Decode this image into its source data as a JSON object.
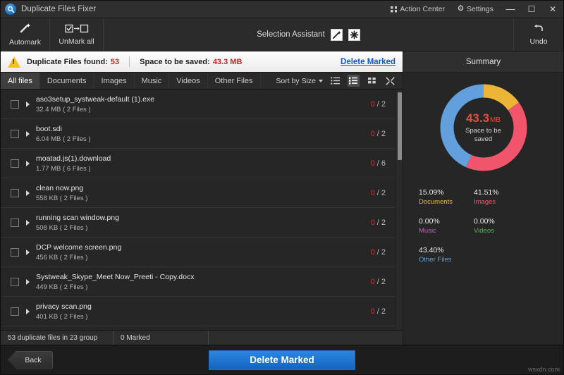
{
  "titlebar": {
    "app_name": "Duplicate Files Fixer",
    "logo_icon": "magnifier-circle-icon",
    "action_center": "Action Center",
    "settings": "Settings",
    "minimize": "—",
    "maximize": "☐",
    "close": "✕"
  },
  "toolbar": {
    "automark": "Automark",
    "unmark_all": "UnMark all",
    "selection_assistant": "Selection Assistant",
    "undo": "Undo",
    "icons": {
      "automark": "magic-wand-icon",
      "unmark_all": "checkbox-to-empty-icon",
      "assistant_wand": "wand-icon",
      "assistant_star": "star-burst-icon",
      "undo": "undo-arrow-icon"
    }
  },
  "infobar": {
    "warning_icon": "warning-triangle-icon",
    "found_label": "Duplicate Files found:",
    "found_value": "53",
    "space_label": "Space to be saved:",
    "space_value": "43.3 MB",
    "delete_marked_link": "Delete Marked"
  },
  "tabs": [
    {
      "label": "All files",
      "active": true
    },
    {
      "label": "Documents",
      "active": false
    },
    {
      "label": "Images",
      "active": false
    },
    {
      "label": "Music",
      "active": false
    },
    {
      "label": "Videos",
      "active": false
    },
    {
      "label": "Other Files",
      "active": false
    }
  ],
  "listcontrols": {
    "sort_by": "Sort by Size",
    "views": [
      "list-view-icon",
      "detail-view-icon",
      "grid-view-icon",
      "expand-view-icon"
    ],
    "selected_view": 1
  },
  "rows": [
    {
      "name": "aso3setup_systweak-default (1).exe",
      "meta": "32.4 MB  ( 2 Files )",
      "marked": "0",
      "total": "2",
      "checked": false
    },
    {
      "name": "boot.sdi",
      "meta": "6.04 MB  ( 2 Files )",
      "marked": "0",
      "total": "2",
      "checked": false
    },
    {
      "name": "moatad.js(1).download",
      "meta": "1.77 MB  ( 6 Files )",
      "marked": "0",
      "total": "6",
      "checked": false
    },
    {
      "name": "clean now.png",
      "meta": "558 KB  ( 2 Files )",
      "marked": "0",
      "total": "2",
      "checked": false
    },
    {
      "name": "running scan window.png",
      "meta": "508 KB  ( 2 Files )",
      "marked": "0",
      "total": "2",
      "checked": false
    },
    {
      "name": "DCP welcome screen.png",
      "meta": "456 KB  ( 2 Files )",
      "marked": "0",
      "total": "2",
      "checked": false
    },
    {
      "name": "Systweak_Skype_Meet Now_Preeti - Copy.docx",
      "meta": "449 KB  ( 2 Files )",
      "marked": "0",
      "total": "2",
      "checked": false
    },
    {
      "name": "privacy scan.png",
      "meta": "401 KB  ( 2 Files )",
      "marked": "0",
      "total": "2",
      "checked": false
    }
  ],
  "statusbar": {
    "duplicates": "53 duplicate files in 23 group",
    "marked": "0 Marked",
    "extra": ""
  },
  "summary": {
    "title": "Summary",
    "center_value": "43.3",
    "center_unit": "MB",
    "center_caption_line1": "Space to be",
    "center_caption_line2": "saved"
  },
  "chart_data": {
    "type": "pie",
    "title": "Summary",
    "center_label": "43.3 MB Space to be saved",
    "categories": [
      "Documents",
      "Images",
      "Music",
      "Videos",
      "Other Files"
    ],
    "values": [
      15.09,
      41.51,
      0.0,
      0.0,
      43.4
    ],
    "value_labels": [
      "15.09%",
      "41.51%",
      "0.00%",
      "0.00%",
      "43.40%"
    ],
    "colors": [
      "#edb537",
      "#f0556b",
      "#c060b8",
      "#4fb84f",
      "#62a0dd"
    ],
    "legend_position": "below",
    "donut": true,
    "units": "%"
  },
  "footer": {
    "back": "Back",
    "delete_marked": "Delete Marked",
    "watermark": "wsxdn.com"
  }
}
